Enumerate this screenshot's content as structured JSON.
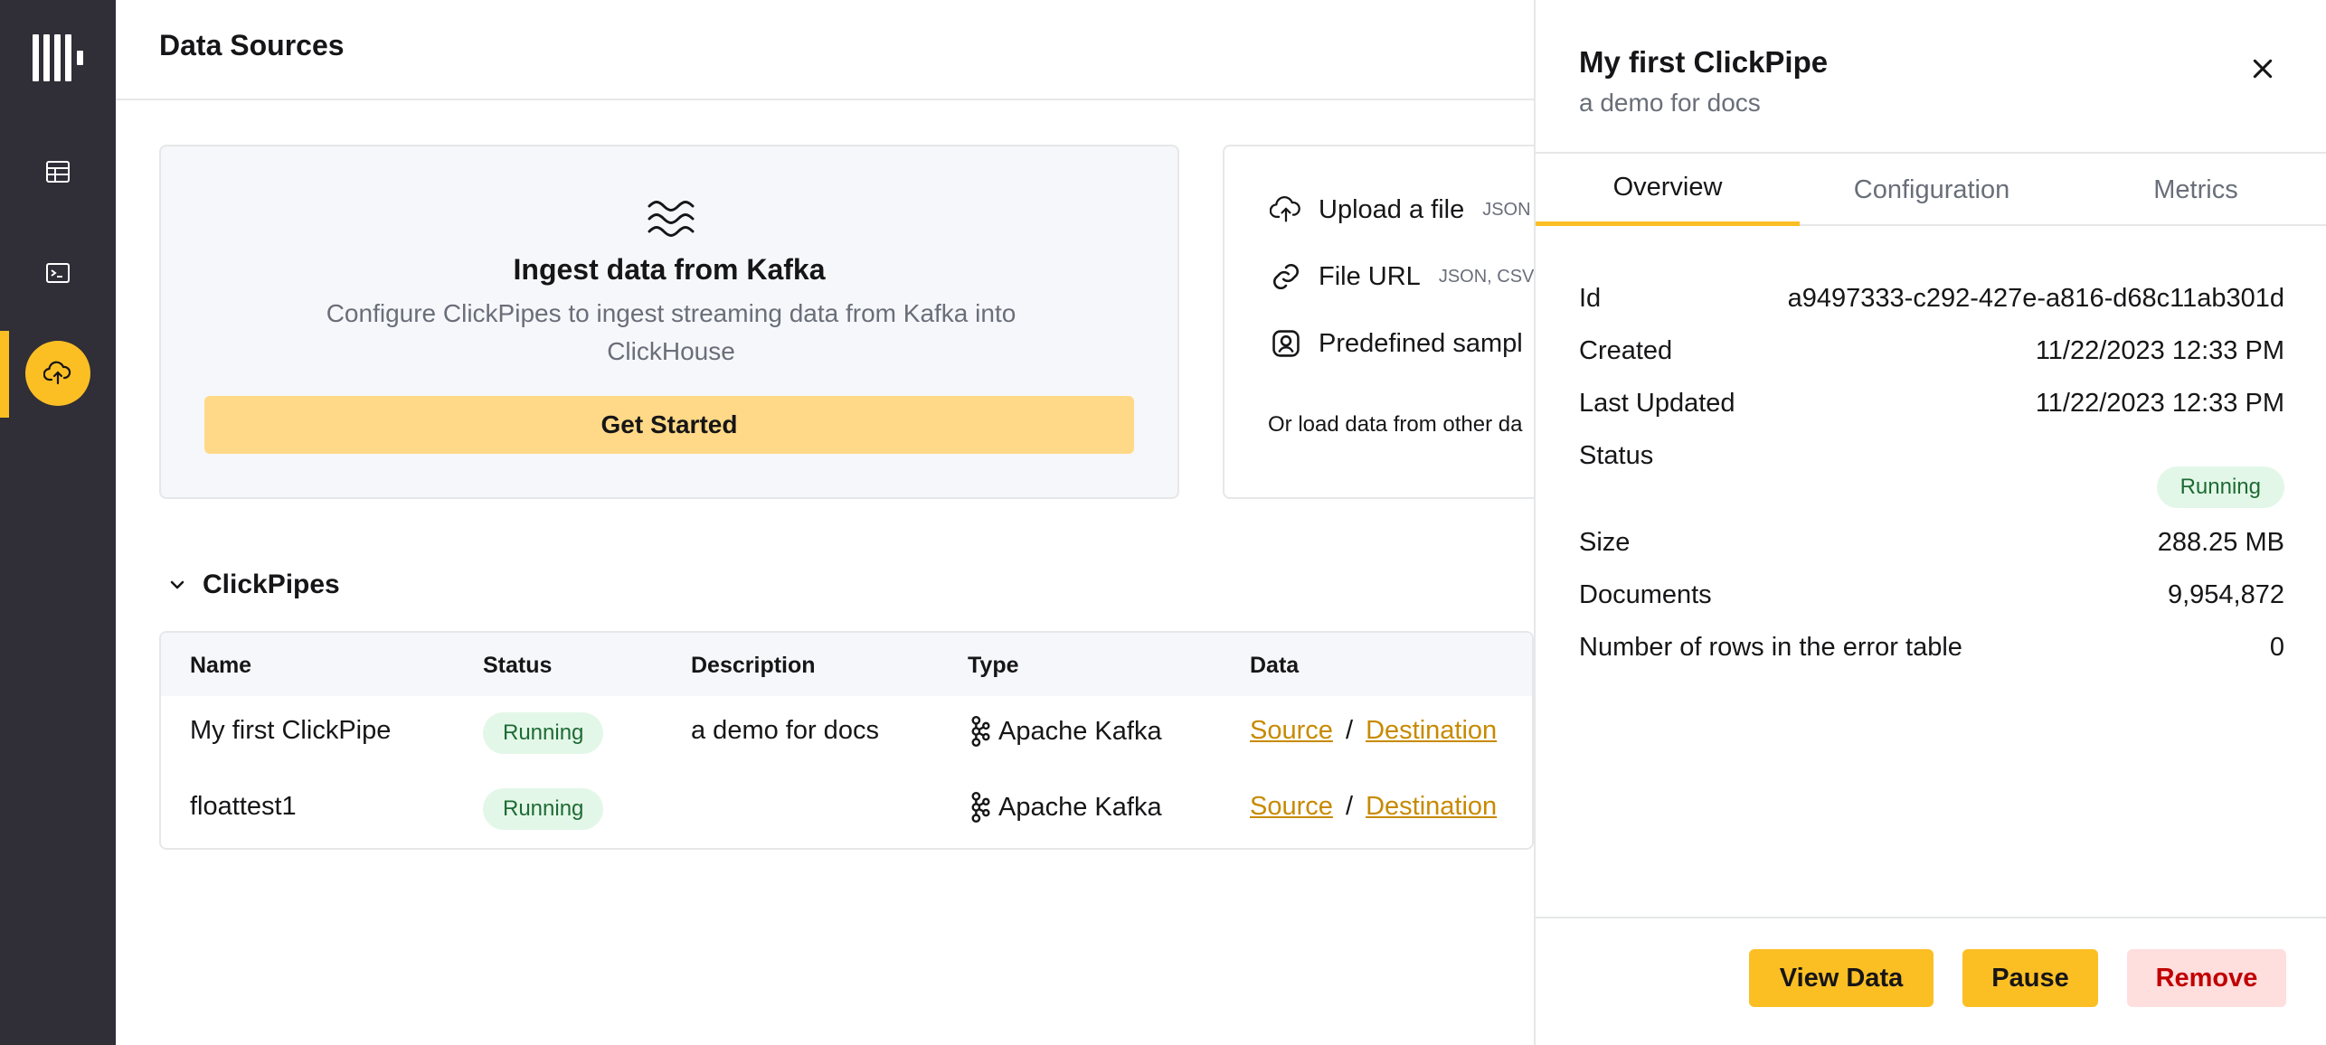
{
  "header": {
    "title": "Data Sources"
  },
  "nav": {
    "items": [
      {
        "icon": "logo-icon"
      },
      {
        "icon": "table-icon"
      },
      {
        "icon": "terminal-icon"
      },
      {
        "icon": "cloud-upload-icon",
        "active": true
      }
    ],
    "accent": "#fbbf24"
  },
  "kafka_card": {
    "title": "Ingest data from Kafka",
    "description": "Configure ClickPipes to ingest streaming data from Kafka into ClickHouse",
    "button": "Get Started"
  },
  "upload_card": {
    "upload_file": {
      "label": "Upload a file",
      "hint": "JSON"
    },
    "file_url": {
      "label": "File URL",
      "hint": "JSON, CSV"
    },
    "predefined": {
      "label": "Predefined sampl"
    },
    "other": "Or load data from other da"
  },
  "clickpipes": {
    "section_label": "ClickPipes",
    "columns": [
      "Name",
      "Status",
      "Description",
      "Type",
      "Data"
    ],
    "rows": [
      {
        "name": "My first ClickPipe",
        "status": "Running",
        "description": "a demo for docs",
        "type": "Apache Kafka",
        "source": "Source",
        "sep": "/",
        "destination": "Destination"
      },
      {
        "name": "floattest1",
        "status": "Running",
        "description": "",
        "type": "Apache Kafka",
        "source": "Source",
        "sep": "/",
        "destination": "Destination"
      }
    ]
  },
  "drawer": {
    "title": "My first ClickPipe",
    "subtitle": "a demo for docs",
    "tabs": [
      "Overview",
      "Configuration",
      "Metrics"
    ],
    "active_tab": "Overview",
    "details": {
      "id_label": "Id",
      "id_value": "a9497333-c292-427e-a816-d68c11ab301d",
      "created_label": "Created",
      "created_value": "11/22/2023 12:33 PM",
      "updated_label": "Last Updated",
      "updated_value": "11/22/2023 12:33 PM",
      "status_label": "Status",
      "status_value": "Running",
      "size_label": "Size",
      "size_value": "288.25 MB",
      "docs_label": "Documents",
      "docs_value": "9,954,872",
      "errors_label": "Number of rows in the error table",
      "errors_value": "0"
    },
    "buttons": {
      "view": "View Data",
      "pause": "Pause",
      "remove": "Remove"
    }
  }
}
